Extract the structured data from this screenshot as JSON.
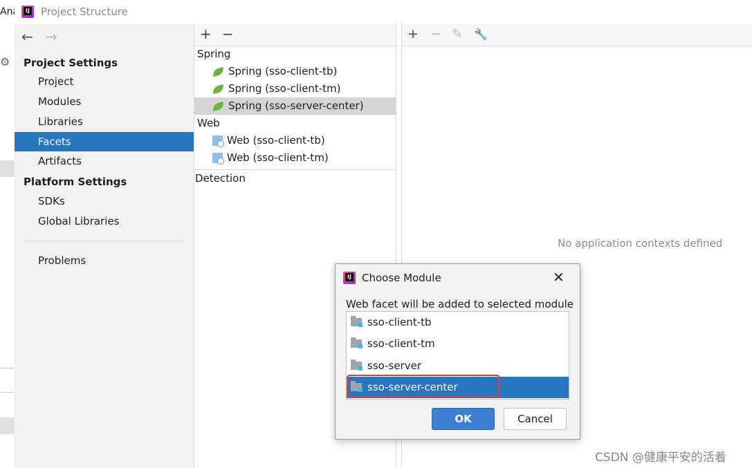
{
  "background": {
    "label": "Ana"
  },
  "window": {
    "title": "Project Structure"
  },
  "nav": {
    "back": "←",
    "forward": "→",
    "project_settings_header": "Project Settings",
    "project_items": [
      "Project",
      "Modules",
      "Libraries",
      "Facets",
      "Artifacts"
    ],
    "selected_item": "Facets",
    "platform_settings_header": "Platform Settings",
    "platform_items": [
      "SDKs",
      "Global Libraries"
    ],
    "problems": "Problems"
  },
  "facets": {
    "toolbar": {
      "add": "+",
      "remove": "−"
    },
    "groups": [
      {
        "name": "Spring",
        "items": [
          "Spring (sso-client-tb)",
          "Spring (sso-client-tm)",
          "Spring (sso-server-center)"
        ]
      },
      {
        "name": "Web",
        "items": [
          "Web (sso-client-tb)",
          "Web (sso-client-tm)"
        ]
      }
    ],
    "selected": "Spring (sso-server-center)",
    "detection": "Detection"
  },
  "details": {
    "toolbar": {
      "add": "+",
      "remove": "−",
      "edit": "✎",
      "settings": "🔧"
    },
    "empty_message": "No application contexts defined"
  },
  "dialog": {
    "title": "Choose Module",
    "close": "✕",
    "label": "Web facet will be added to selected module",
    "modules": [
      "sso-client-tb",
      "sso-client-tm",
      "sso-server",
      "sso-server-center"
    ],
    "selected": "sso-server-center",
    "ok": "OK",
    "cancel": "Cancel"
  },
  "colors": {
    "selection": "#2675bf",
    "highlight_border": "#e53935",
    "spring_leaf": "#6db33f"
  },
  "watermark": "CSDN @健康平安的活着"
}
